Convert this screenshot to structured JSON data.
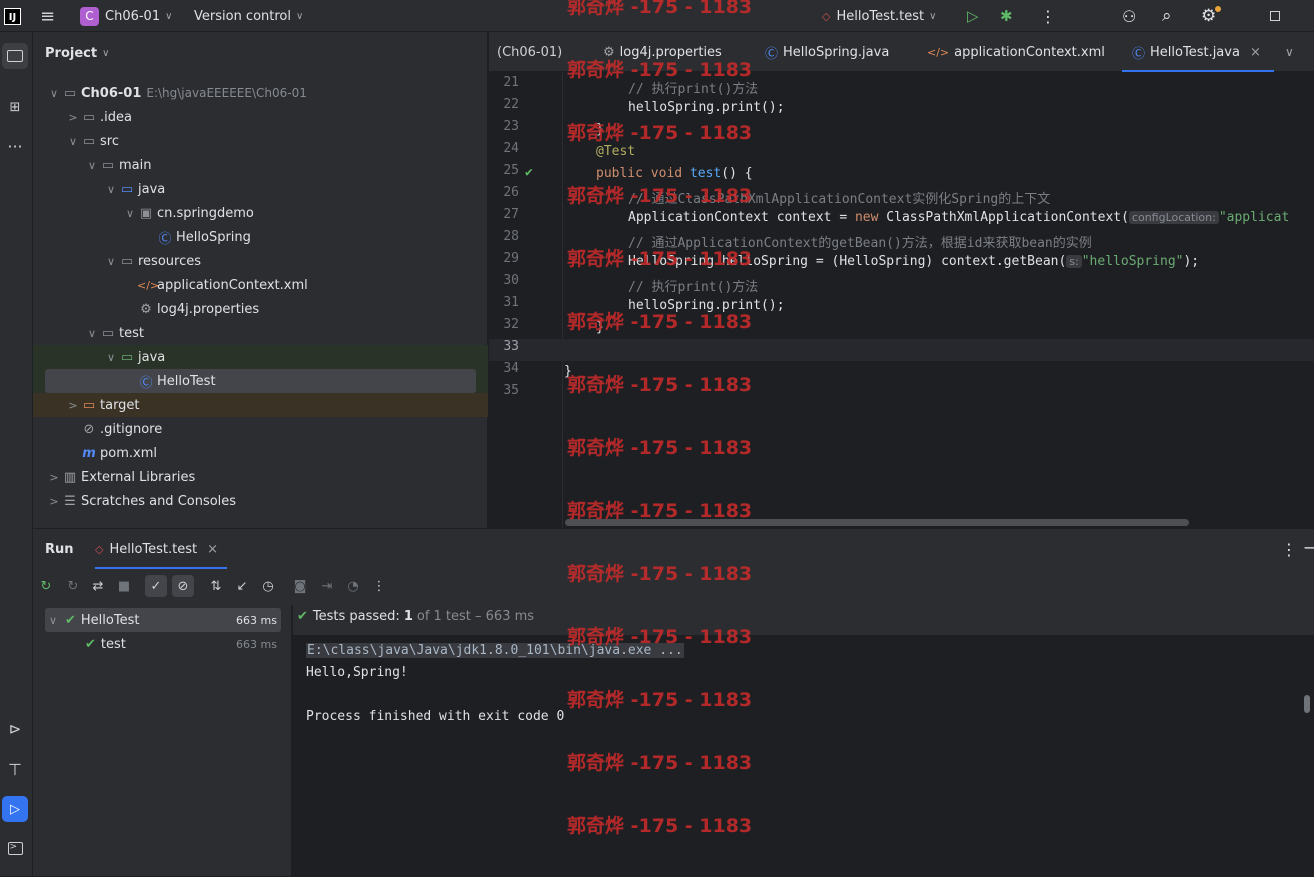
{
  "titlebar": {
    "app_logo": "IJ",
    "project_badge": "C",
    "project_name": "Ch06-01",
    "version_control": "Version control",
    "run_config": "HelloTest.test"
  },
  "sidebar_left": {
    "icons": [
      "folder-icon",
      "structure-icon",
      "more-icon",
      "services-icon",
      "build-icon",
      "run-icon",
      "terminal-icon"
    ]
  },
  "project_panel": {
    "title": "Project",
    "root_name": "Ch06-01",
    "root_path": "E:\\hg\\javaEEEEEE\\Ch06-01",
    "items": [
      {
        "label": ".idea"
      },
      {
        "label": "src"
      },
      {
        "label": "main"
      },
      {
        "label": "java"
      },
      {
        "label": "cn.springdemo"
      },
      {
        "label": "HelloSpring"
      },
      {
        "label": "resources"
      },
      {
        "label": "applicationContext.xml"
      },
      {
        "label": "log4j.properties"
      },
      {
        "label": "test"
      },
      {
        "label": "java"
      },
      {
        "label": "HelloTest"
      },
      {
        "label": "target"
      },
      {
        "label": ".gitignore"
      },
      {
        "label": "pom.xml"
      },
      {
        "label": "External Libraries"
      },
      {
        "label": "Scratches and Consoles"
      }
    ]
  },
  "editor": {
    "tabs": [
      {
        "label": "(Ch06-01)"
      },
      {
        "label": "log4j.properties"
      },
      {
        "label": "HelloSpring.java"
      },
      {
        "label": "applicationContext.xml"
      },
      {
        "label": "HelloTest.java"
      }
    ],
    "lines": [
      {
        "num": "21",
        "comment": "// 执行print()方法"
      },
      {
        "num": "22",
        "code": "helloSpring.print();"
      },
      {
        "num": "23",
        "brace": "}"
      },
      {
        "num": "24",
        "annotation": "@Test"
      },
      {
        "num": "25",
        "kw1": "public",
        "kw2": "void",
        "fn": "test",
        "rest": "() {"
      },
      {
        "num": "26",
        "comment": "// 通过ClassPathXmlApplicationContext实例化Spring的上下文"
      },
      {
        "num": "27",
        "code_a": "ApplicationContext context = ",
        "kw": "new",
        "code_b": " ClassPathXmlApplicationContext(",
        "hint": "configLocation:",
        "str": "\"applicat"
      },
      {
        "num": "28",
        "comment": "// 通过ApplicationContext的getBean()方法，根据id来获取bean的实例"
      },
      {
        "num": "29",
        "code_a": "HelloSpring helloSpring = (HelloSpring) context.getBean(",
        "hint": "s:",
        "str": "\"helloSpring\"",
        "code_b": ");"
      },
      {
        "num": "30",
        "comment": "// 执行print()方法"
      },
      {
        "num": "31",
        "code": "helloSpring.print();"
      },
      {
        "num": "32",
        "brace": "}"
      },
      {
        "num": "33"
      },
      {
        "num": "34",
        "brace": "}"
      },
      {
        "num": "35"
      }
    ]
  },
  "run_panel": {
    "title": "Run",
    "tab_label": "HelloTest.test",
    "tree": [
      {
        "name": "HelloTest",
        "time": "663 ms"
      },
      {
        "name": "test",
        "time": "663 ms"
      }
    ],
    "status_bold": "Tests passed:",
    "status_count": "1",
    "status_rest": "of 1 test – 663 ms",
    "console": [
      "E:\\class\\java\\Java\\jdk1.8.0_101\\bin\\java.exe ...",
      "Hello,Spring!",
      "",
      "Process finished with exit code 0"
    ]
  },
  "watermark": "郭奇烨 -175 - 1183",
  "colors": {
    "accent": "#3574f0",
    "success": "#5fb865",
    "badge_purple": "#b05fd1",
    "watermark": "#c42b2b"
  }
}
